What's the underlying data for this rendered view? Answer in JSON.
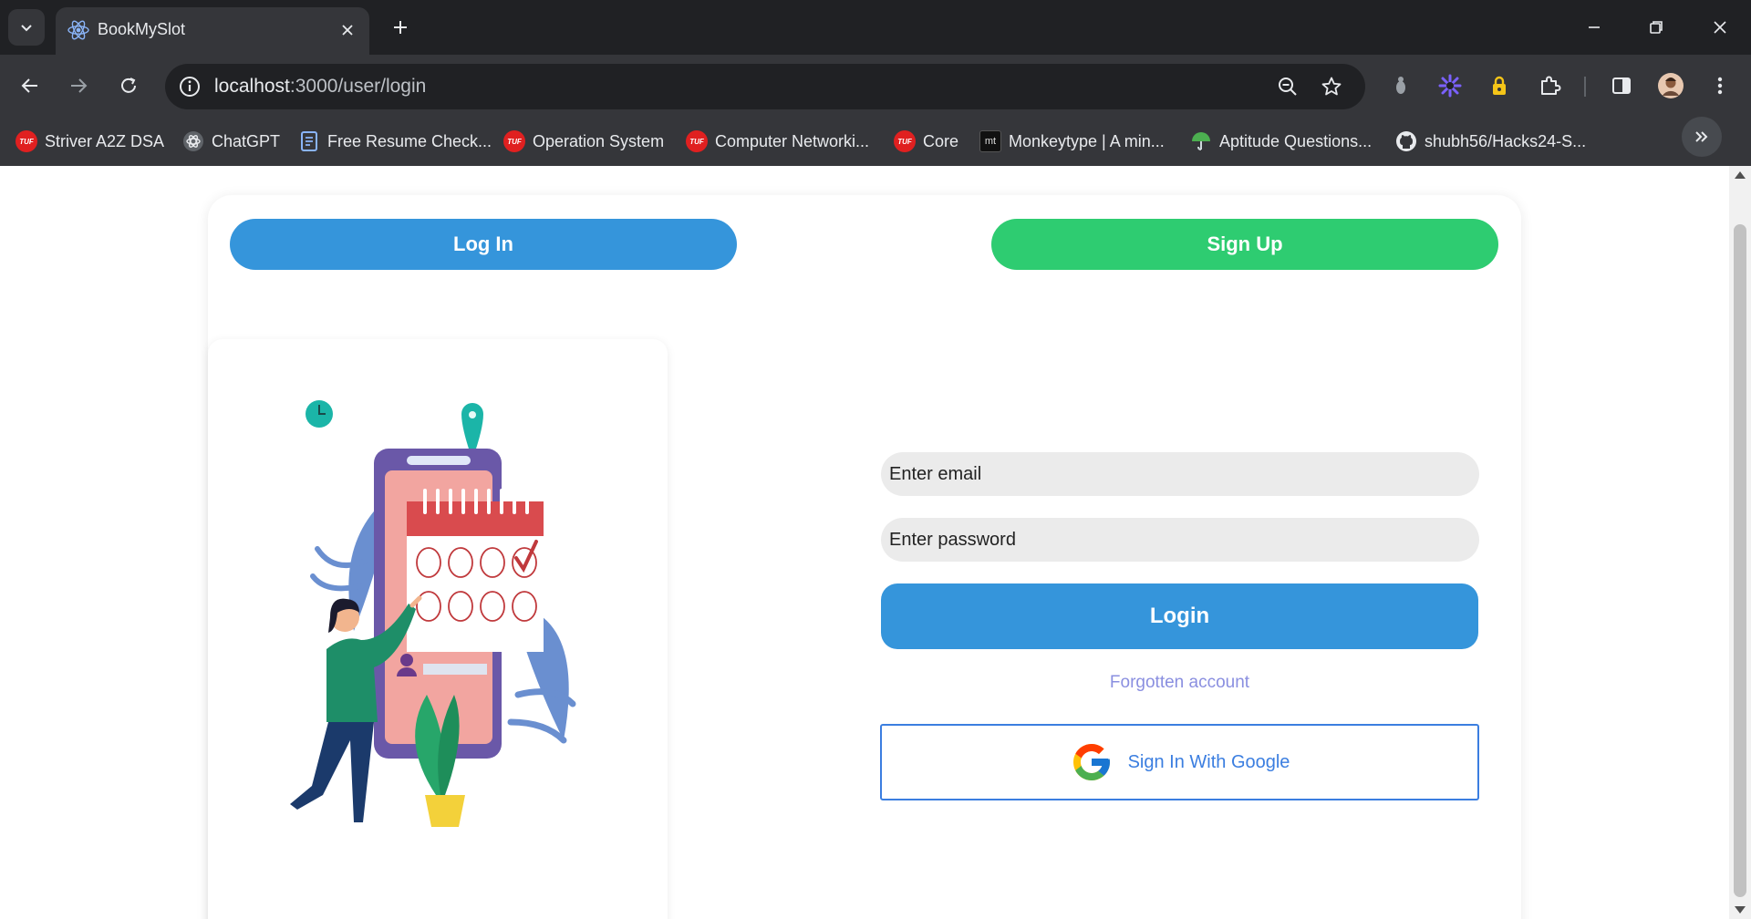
{
  "browser": {
    "tab_title": "BookMySlot",
    "url_host": "localhost",
    "url_path": ":3000/user/login",
    "bookmarks": [
      {
        "label": "Striver A2Z DSA",
        "icon": "tuf-icon"
      },
      {
        "label": "ChatGPT",
        "icon": "chatgpt-icon"
      },
      {
        "label": "Free Resume Check...",
        "icon": "resume-icon"
      },
      {
        "label": "Operation System",
        "icon": "tuf-icon"
      },
      {
        "label": "Computer Networki...",
        "icon": "tuf-icon"
      },
      {
        "label": "Core",
        "icon": "tuf-icon"
      },
      {
        "label": "Monkeytype | A min...",
        "icon": "monkeytype-icon"
      },
      {
        "label": "Aptitude Questions...",
        "icon": "indiabix-icon"
      },
      {
        "label": "shubh56/Hacks24-S...",
        "icon": "github-icon"
      }
    ],
    "tuf_badge": "TUF",
    "monkeytype_badge": "mt"
  },
  "page": {
    "tabs": {
      "login_label": "Log In",
      "signup_label": "Sign Up"
    },
    "form": {
      "email_placeholder": "Enter email",
      "password_placeholder": "Enter password",
      "login_button": "Login",
      "forgot_link": "Forgotten account",
      "google_button": "Sign In With Google"
    }
  },
  "colors": {
    "login_blue": "#3595db",
    "signup_green": "#2ecc71",
    "google_border": "#3b7ee0",
    "forgot_link": "#8a8fe0"
  }
}
